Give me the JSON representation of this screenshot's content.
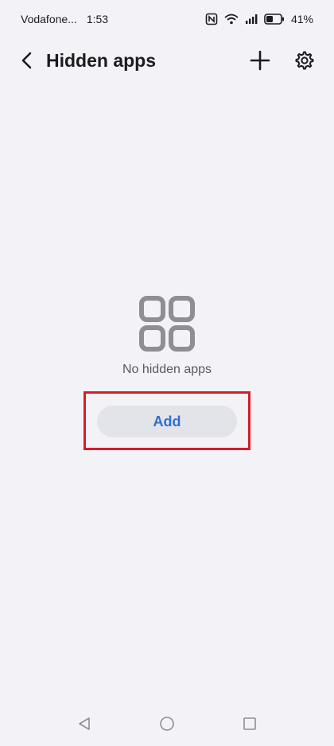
{
  "status_bar": {
    "carrier": "Vodafone...",
    "time": "1:53",
    "battery_percent": "41%",
    "icons": [
      "nfc-icon",
      "wifi-icon",
      "signal-icon",
      "battery-icon"
    ]
  },
  "header": {
    "title": "Hidden apps",
    "back_icon": "chevron-left-icon",
    "add_icon": "plus-icon",
    "settings_icon": "gear-icon"
  },
  "empty_state": {
    "icon": "apps-grid-icon",
    "message": "No hidden apps",
    "button_label": "Add"
  },
  "colors": {
    "background": "#f2f2f7",
    "accent": "#2f6fd0",
    "highlight": "#d81b2b",
    "button_bg": "#e3e3ea"
  },
  "nav_bar": {
    "icons": [
      "nav-back-icon",
      "nav-home-icon",
      "nav-recents-icon"
    ]
  }
}
